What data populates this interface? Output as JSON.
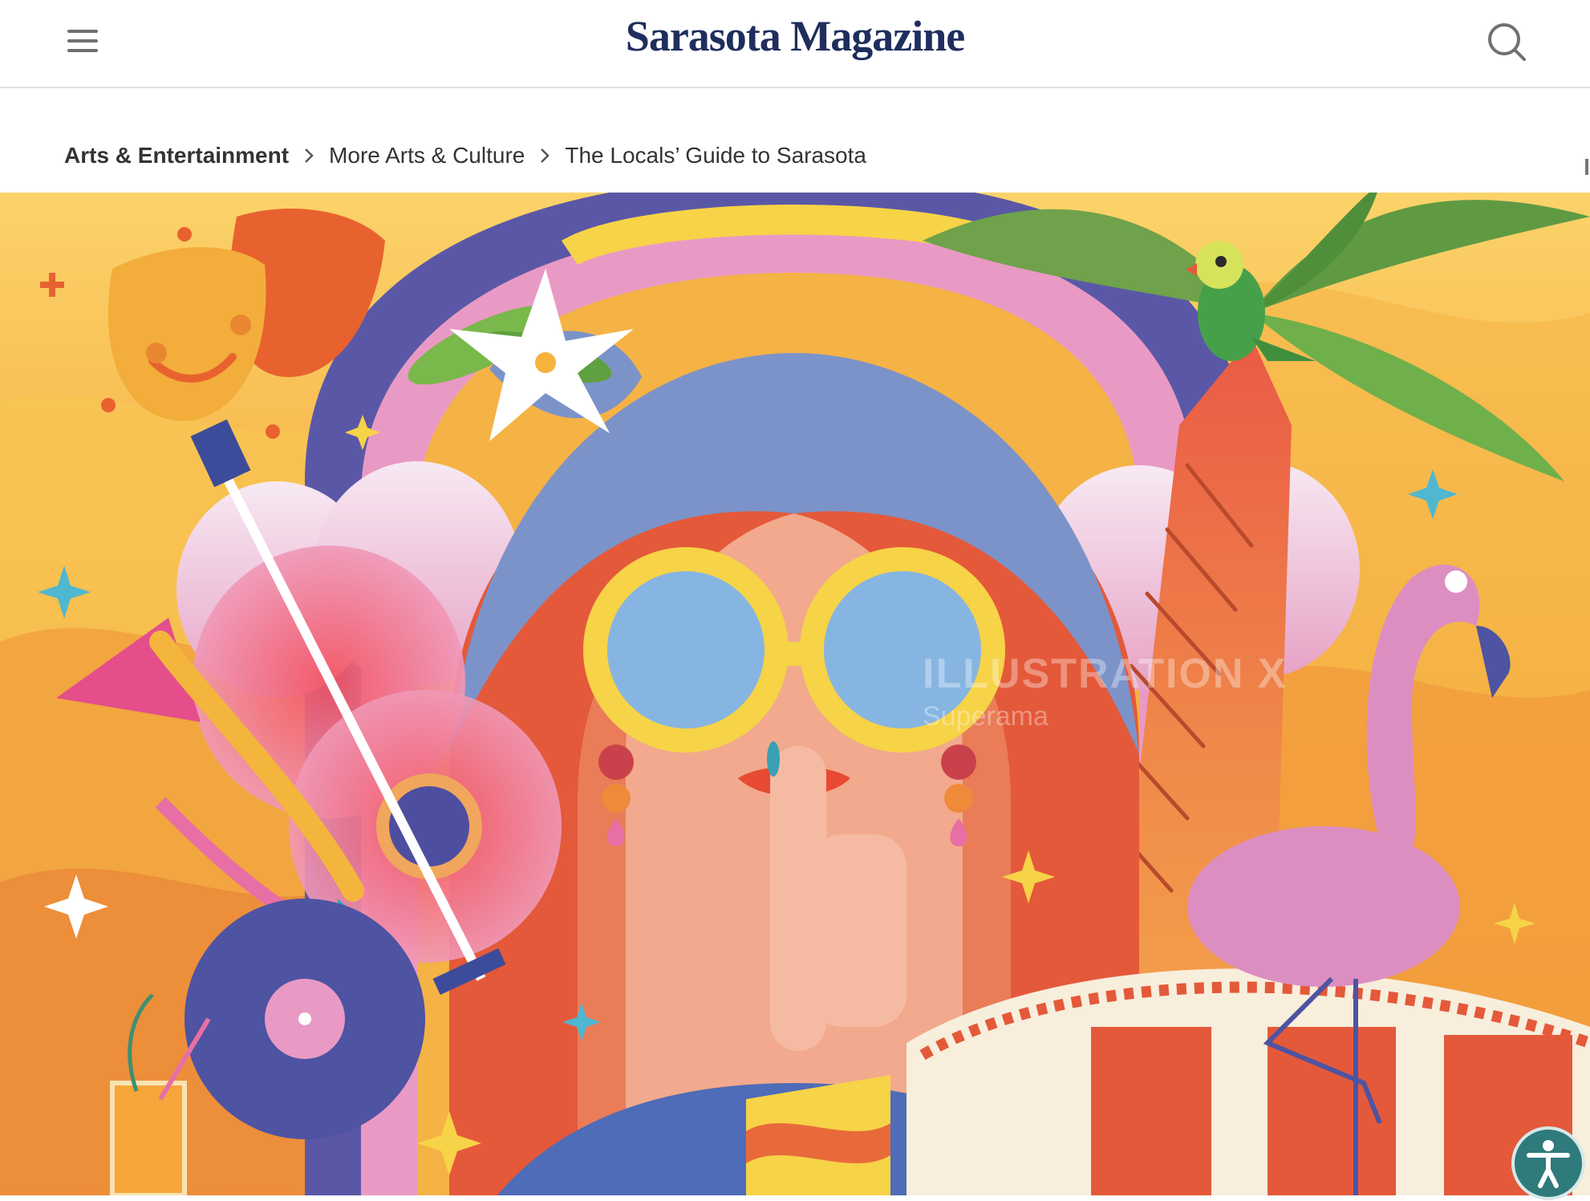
{
  "header": {
    "logo_text": "Sarasota Magazine",
    "menu_icon": "hamburger-menu-icon",
    "search_icon": "search-icon"
  },
  "breadcrumb": {
    "items": [
      {
        "label": "Arts & Entertainment"
      },
      {
        "label": "More Arts & Culture"
      },
      {
        "label": "The Locals’ Guide to Sarasota"
      }
    ],
    "separator_icon": "chevron-right-icon"
  },
  "hero": {
    "watermark_main": "ILLUSTRATION X",
    "watermark_sub": "Superama"
  },
  "accessibility": {
    "icon": "accessibility-icon"
  },
  "colors": {
    "logo": "#1f2e5e",
    "text": "#333333",
    "accessibility_button": "#2f7a7b",
    "hair": "#e4593a",
    "sky": "#f6b33c",
    "face": "#f2a98d"
  }
}
